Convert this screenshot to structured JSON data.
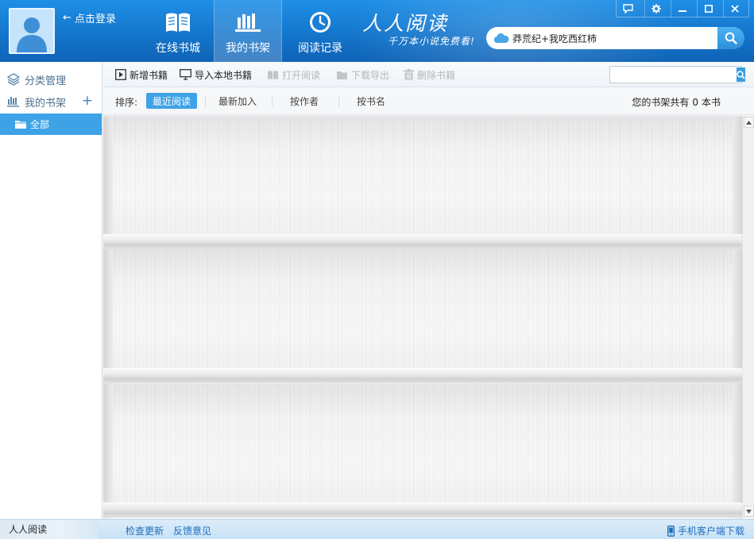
{
  "header": {
    "login_label": "点击登录",
    "nav_tabs": [
      {
        "label": "在线书城",
        "icon": "book-open-icon"
      },
      {
        "label": "我的书架",
        "icon": "bookshelf-icon",
        "active": true
      },
      {
        "label": "阅读记录",
        "icon": "clock-icon"
      }
    ],
    "brand_title": "人人阅读",
    "brand_slogan": "千万本小说免费看!",
    "search_value": "莽荒纪+我吃西红柿",
    "window_controls": [
      "chat-icon",
      "settings-icon",
      "minimize-icon",
      "maximize-icon",
      "close-icon"
    ]
  },
  "sidebar": {
    "category_manage": "分类管理",
    "my_shelf": "我的书架",
    "add_symbol": "+",
    "all_label": "全部"
  },
  "toolbar": {
    "add_book": "新增书籍",
    "import_local": "导入本地书籍",
    "open_read": "打开阅读",
    "download_export": "下载导出",
    "delete_book": "删除书籍",
    "search_value": ""
  },
  "sortbar": {
    "label": "排序:",
    "options": [
      "最近阅读",
      "最新加入",
      "按作者",
      "按书名"
    ],
    "active_index": 0,
    "count_prefix": "您的书架共有",
    "count": "0",
    "count_suffix": "本书"
  },
  "statusbar": {
    "app_name": "人人阅读",
    "check_update": "检查更新",
    "feedback": "反馈意见",
    "mobile_download": "手机客户端下载"
  },
  "colors": {
    "header_blue": "#1476cc",
    "accent": "#3ea3e6",
    "link": "#1e6fbd"
  }
}
